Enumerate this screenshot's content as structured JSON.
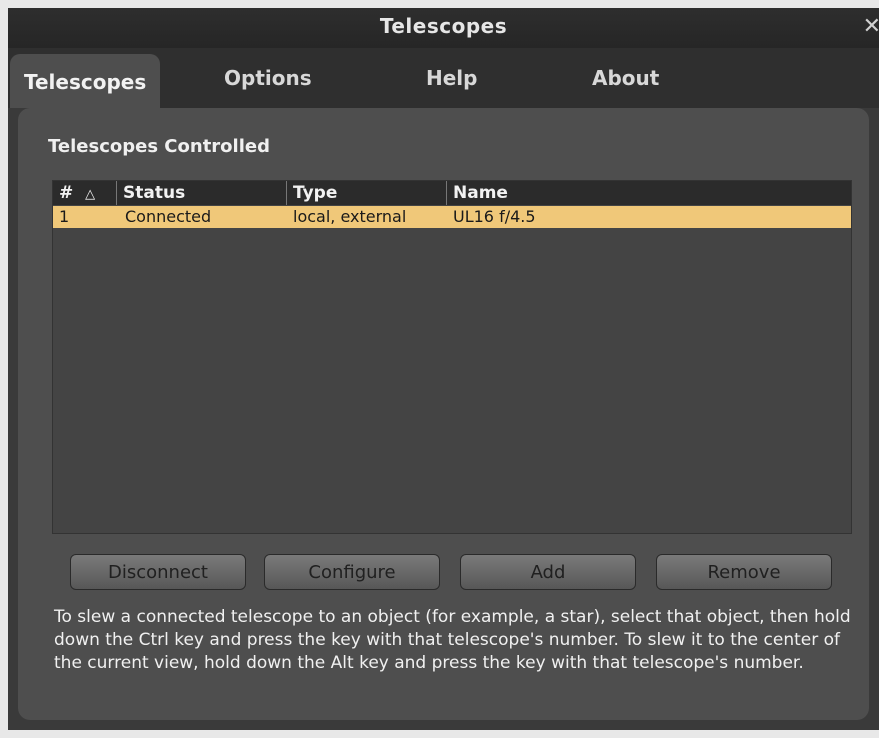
{
  "window": {
    "title": "Telescopes",
    "close_glyph": "✕"
  },
  "tabs": [
    {
      "label": "Telescopes",
      "active": true
    },
    {
      "label": "Options",
      "active": false
    },
    {
      "label": "Help",
      "active": false
    },
    {
      "label": "About",
      "active": false
    }
  ],
  "section": {
    "title": "Telescopes Controlled"
  },
  "table": {
    "columns": [
      {
        "label": "#",
        "sort_icon": "△"
      },
      {
        "label": "Status"
      },
      {
        "label": "Type"
      },
      {
        "label": "Name"
      }
    ],
    "rows": [
      {
        "number": "1",
        "status": "Connected",
        "type": "local, external",
        "name": "UL16 f/4.5",
        "selected": true
      }
    ]
  },
  "buttons": {
    "disconnect": "Disconnect",
    "configure": "Configure",
    "add": "Add",
    "remove": "Remove"
  },
  "help_text": "To slew a connected telescope to an object (for example, a star), select that object, then hold down the Ctrl key and press the key with that telescope's number. To slew it to the center of the current view, hold down the Alt key and press the key with that telescope's number.",
  "colors": {
    "selected_row": "#f0c879",
    "panel": "#4e4e4e",
    "header": "#2b2b2b"
  }
}
